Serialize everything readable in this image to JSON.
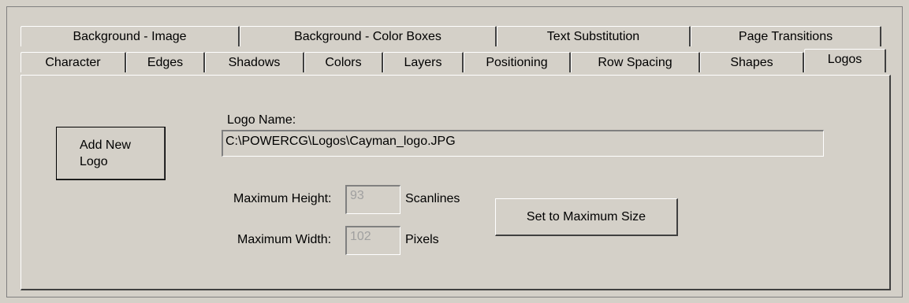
{
  "tabs_back_row": [
    {
      "label": "Background - Image"
    },
    {
      "label": "Background - Color Boxes"
    },
    {
      "label": "Text Substitution"
    },
    {
      "label": "Page Transitions"
    }
  ],
  "tabs_front_row": [
    {
      "label": "Character"
    },
    {
      "label": "Edges"
    },
    {
      "label": "Shadows"
    },
    {
      "label": "Colors"
    },
    {
      "label": "Layers"
    },
    {
      "label": "Positioning"
    },
    {
      "label": "Row Spacing"
    },
    {
      "label": "Shapes"
    },
    {
      "label": "Logos",
      "active": true
    }
  ],
  "logos": {
    "add_new_logo_label": "Add New Logo",
    "add_new_logo_line1": "Add New",
    "add_new_logo_line2": "Logo",
    "logo_name_label": "Logo Name:",
    "logo_name_value": "C:\\POWERCG\\Logos\\Cayman_logo.JPG",
    "max_height_label": "Maximum Height:",
    "max_height_value": "93",
    "max_height_unit": "Scanlines",
    "max_width_label": "Maximum Width:",
    "max_width_value": "102",
    "max_width_unit": "Pixels",
    "set_max_size_label": "Set to Maximum Size"
  }
}
